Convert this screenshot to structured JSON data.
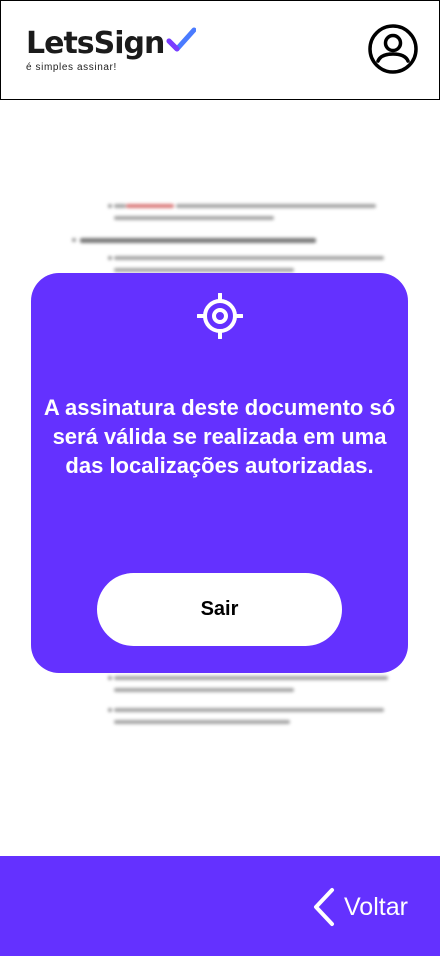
{
  "header": {
    "logo_text": "LetsSign",
    "logo_tagline": "é simples assinar!",
    "profile_icon": "user-circle-icon",
    "brand_color": "#6431ff"
  },
  "modal": {
    "icon": "location-crosshair-icon",
    "message": "A assinatura deste documento só será válida se realizada em uma das localizações autorizadas.",
    "exit_label": "Sair"
  },
  "footer": {
    "back_icon": "chevron-left-icon",
    "back_label": "Voltar"
  }
}
